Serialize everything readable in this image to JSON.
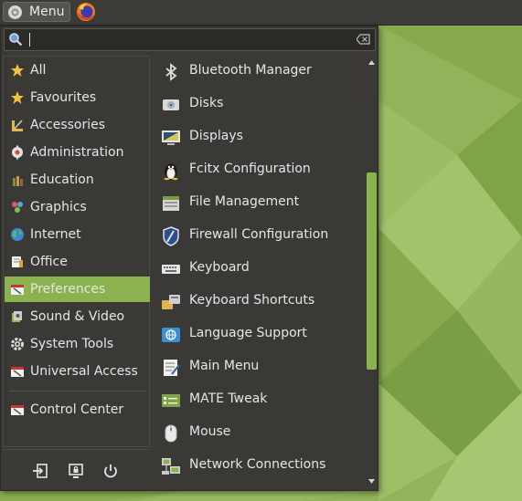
{
  "panel": {
    "menu_label": "Menu",
    "menu_icon": "mate-logo-icon",
    "launcher_icon": "firefox-icon"
  },
  "search": {
    "value": "",
    "placeholder": ""
  },
  "categories": [
    {
      "label": "All",
      "icon": "star-icon"
    },
    {
      "label": "Favourites",
      "icon": "star-icon"
    },
    {
      "label": "Accessories",
      "icon": "accessories-icon"
    },
    {
      "label": "Administration",
      "icon": "administration-icon"
    },
    {
      "label": "Education",
      "icon": "education-icon"
    },
    {
      "label": "Graphics",
      "icon": "graphics-icon"
    },
    {
      "label": "Internet",
      "icon": "globe-icon"
    },
    {
      "label": "Office",
      "icon": "office-icon"
    },
    {
      "label": "Preferences",
      "icon": "preferences-icon",
      "selected": true
    },
    {
      "label": "Sound & Video",
      "icon": "sound-video-icon"
    },
    {
      "label": "System Tools",
      "icon": "gear-icon"
    },
    {
      "label": "Universal Access",
      "icon": "universal-access-icon"
    },
    {
      "label": "Control Center",
      "icon": "control-center-icon"
    }
  ],
  "bottom_actions": [
    {
      "name": "logout-icon"
    },
    {
      "name": "lock-screen-icon"
    },
    {
      "name": "power-icon"
    }
  ],
  "apps": [
    {
      "label": "Bluetooth Manager",
      "icon": "bluetooth-icon"
    },
    {
      "label": "Disks",
      "icon": "disks-icon"
    },
    {
      "label": "Displays",
      "icon": "displays-icon"
    },
    {
      "label": "Fcitx Configuration",
      "icon": "penguin-icon"
    },
    {
      "label": "File Management",
      "icon": "file-management-icon"
    },
    {
      "label": "Firewall Configuration",
      "icon": "shield-icon"
    },
    {
      "label": "Keyboard",
      "icon": "keyboard-icon"
    },
    {
      "label": "Keyboard Shortcuts",
      "icon": "keyboard-shortcuts-icon"
    },
    {
      "label": "Language Support",
      "icon": "language-icon"
    },
    {
      "label": "Main Menu",
      "icon": "main-menu-icon"
    },
    {
      "label": "MATE Tweak",
      "icon": "mate-tweak-icon"
    },
    {
      "label": "Mouse",
      "icon": "mouse-icon"
    },
    {
      "label": "Network Connections",
      "icon": "network-icon"
    }
  ],
  "colors": {
    "accent": "#8ab34f",
    "menu_bg": "#3a3936",
    "panel_bg": "#3c3b37",
    "text": "#e6e6e4"
  }
}
